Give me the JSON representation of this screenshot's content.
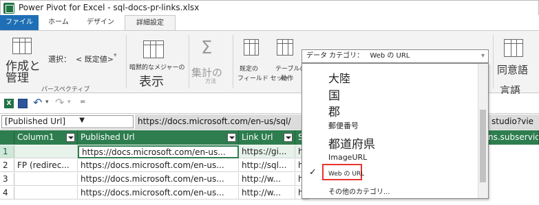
{
  "window": {
    "title": "Power Pivot for Excel - sql-docs-pr-links.xlsx"
  },
  "tabs": [
    {
      "label": "ファイル"
    },
    {
      "label": "ホーム"
    },
    {
      "label": "デザイン"
    },
    {
      "label": "詳細設定"
    }
  ],
  "ribbon": {
    "perspective_big": "作成と\n管理",
    "select_label": "選択：",
    "select_value": "< 既定値>",
    "perspective_group": "パースペクティブ",
    "implicit_measure_label": "暗黙的なメジャーの",
    "implicit_measure_big": "表示",
    "summarize_big": "集計の",
    "summarize_small": "方法",
    "default_field_set_l1": "既定の",
    "default_field_set_l2": "フィールド セット",
    "table_behavior_l1": "テーブルの",
    "table_behavior_l2": "動作",
    "synonyms_big": "同意語",
    "language_big": "言語"
  },
  "data_category": {
    "label": "データ カテゴリ：",
    "value": "Web の URL",
    "items": [
      {
        "label": "大陸"
      },
      {
        "label": "国"
      },
      {
        "label": "郡"
      },
      {
        "label": "郵便番号"
      },
      {
        "label": "都道府県"
      },
      {
        "label": "ImageURL"
      },
      {
        "label": "Web の URL",
        "selected": true
      },
      {
        "label": "その他のカテゴリ..."
      }
    ],
    "check_glyph": "✓",
    "highlight_color": "#e8332d"
  },
  "formula_bar": {
    "name_box": "[Published Url]",
    "value_left": "https://docs.microsoft.com/en-us/sql/",
    "value_right": "studio?vie"
  },
  "grid": {
    "header_color": "#2e7d4f",
    "columns": [
      {
        "label": "Column1"
      },
      {
        "label": "Published Url"
      },
      {
        "label": "Link Url"
      },
      {
        "label": "S"
      },
      {
        "label": "ns.subservic"
      }
    ],
    "rows": [
      {
        "num": "1",
        "cells": [
          "",
          "https://docs.microsoft.com/en-us...",
          "https://gi...",
          "h"
        ]
      },
      {
        "num": "2",
        "cells": [
          "FP (redirec...",
          "https://docs.microsoft.com/en-us...",
          "http://sql...",
          "h"
        ]
      },
      {
        "num": "3",
        "cells": [
          "",
          "https://docs.microsoft.com/en-us...",
          "http://w...",
          "h"
        ]
      },
      {
        "num": "4",
        "cells": [
          "",
          "https://docs.microsoft.com/en-us...",
          "http://w...",
          "h"
        ]
      }
    ]
  }
}
